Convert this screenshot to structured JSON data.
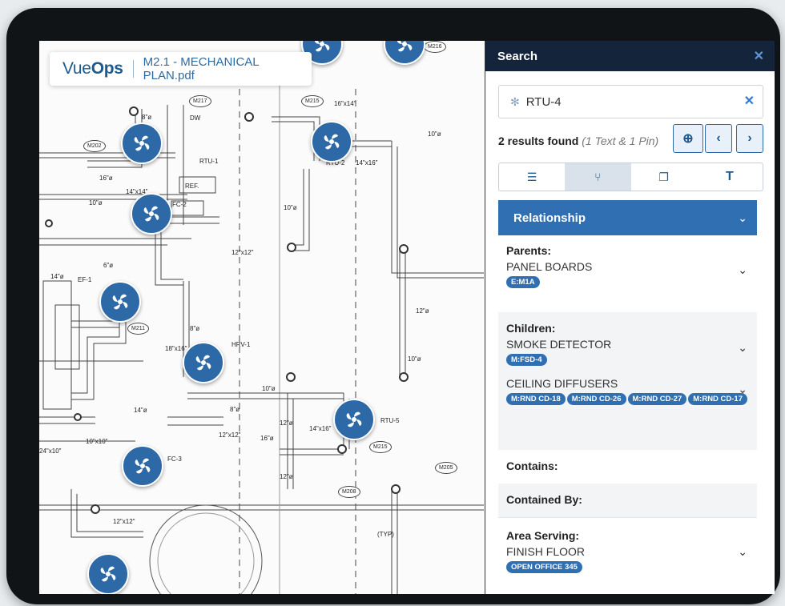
{
  "brand": {
    "logo_a": "Vue",
    "logo_b": "Ops",
    "filename": "M2.1 - MECHANICAL PLAN.pdf"
  },
  "plan_labels": {
    "rtu1": "RTU-1",
    "rtu2": "RTU-2",
    "rtu5": "RTU-5",
    "fc2": "FC-2",
    "fc3": "FC-3",
    "ef1": "EF-1",
    "hrv1": "HRV-1",
    "d14x14": "14\"x14\"",
    "d16x14": "16\"x14\"",
    "d14x16": "14\"x16\"",
    "d12x12": "12\"x12\"",
    "d18x16": "18\"x16\"",
    "d24x10": "24\"x10\"",
    "d10x10": "10\"x10\"",
    "d10": "10\"ø",
    "d12": "12\"ø",
    "d8": "8\"ø",
    "d16": "16\"ø",
    "d14": "14\"ø",
    "d6": "6\"ø",
    "m217": "M217",
    "m202": "M202",
    "m215": "M215",
    "m211": "M211",
    "m216": "M216",
    "m205": "M205",
    "m208": "M208",
    "typ": "(TYP)",
    "ref": "REF.",
    "dw": "DW"
  },
  "panel": {
    "title": "Search",
    "close_icon": "close-icon",
    "search_value": "RTU-4",
    "results_count": "2 results found",
    "results_detail": "(1 Text & 1 Pin)",
    "tabs": [
      "list-icon",
      "relationship-icon",
      "documents-icon",
      "text-icon"
    ],
    "relationship": "Relationship",
    "parents_h": "Parents:",
    "parents_name": "PANEL BOARDS",
    "parents_tag": "E:M1A",
    "children_h": "Children:",
    "child1_name": "SMOKE DETECTOR",
    "child1_tag": "M:FSD-4",
    "child2_name": "CEILING DIFFUSERS",
    "child2_tags": [
      "M:RND CD-18",
      "M:RND CD-26",
      "M:RND CD-27",
      "M:RND CD-17"
    ],
    "contains_h": "Contains:",
    "contained_by_h": "Contained By:",
    "area_h": "Area Serving:",
    "area_name": "FINISH FLOOR",
    "area_tag": "OPEN OFFICE 345"
  },
  "colors": {
    "accent": "#2f6fb2",
    "header": "#14243b",
    "pin": "#2d69a7"
  }
}
